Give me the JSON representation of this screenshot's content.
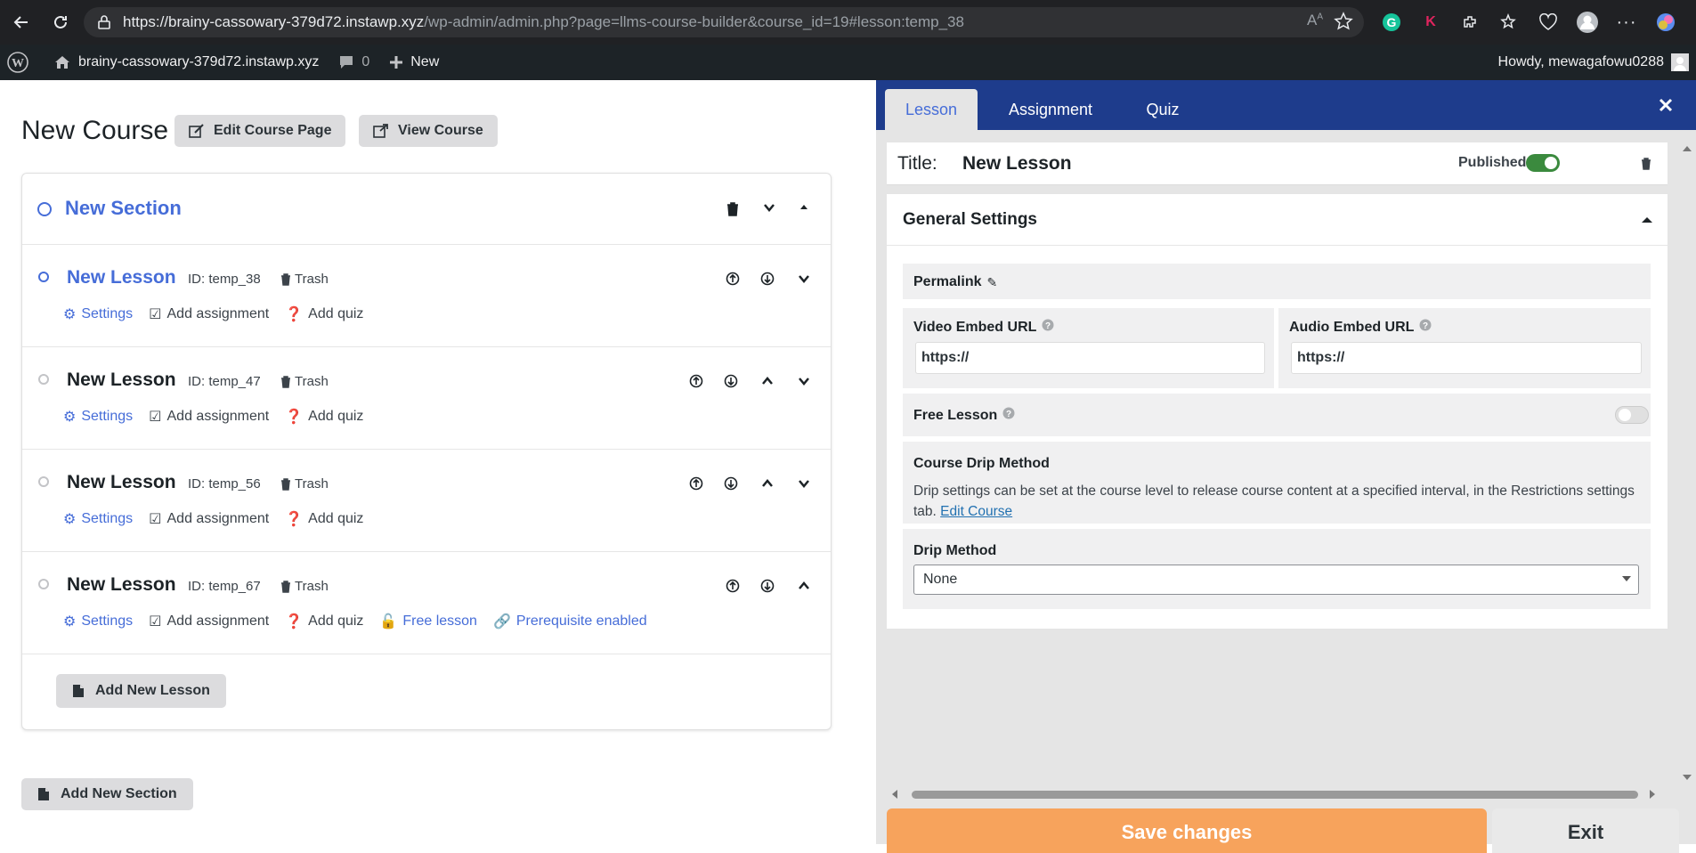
{
  "browser": {
    "url_host": "https://brainy-cassowary-379d72.instawp.xyz",
    "url_path": "/wp-admin/admin.php?page=llms-course-builder&course_id=19#lesson:temp_38"
  },
  "admin_bar": {
    "site_name": "brainy-cassowary-379d72.instawp.xyz",
    "comments_count": "0",
    "new_label": "New",
    "howdy": "Howdy, mewagafowu0288"
  },
  "course": {
    "title": "New Course",
    "edit_page_label": "Edit Course Page",
    "view_course_label": "View Course",
    "add_new_section_label": "Add New Section"
  },
  "section": {
    "title": "New Section",
    "add_new_lesson_label": "Add New Lesson",
    "lessons": [
      {
        "title": "New Lesson",
        "id_label": "ID: temp_38",
        "trash": "Trash",
        "settings": "Settings",
        "add_assignment": "Add assignment",
        "add_quiz": "Add quiz"
      },
      {
        "title": "New Lesson",
        "id_label": "ID: temp_47",
        "trash": "Trash",
        "settings": "Settings",
        "add_assignment": "Add assignment",
        "add_quiz": "Add quiz"
      },
      {
        "title": "New Lesson",
        "id_label": "ID: temp_56",
        "trash": "Trash",
        "settings": "Settings",
        "add_assignment": "Add assignment",
        "add_quiz": "Add quiz"
      },
      {
        "title": "New Lesson",
        "id_label": "ID: temp_67",
        "trash": "Trash",
        "settings": "Settings",
        "add_assignment": "Add assignment",
        "add_quiz": "Add quiz",
        "free_lesson": "Free lesson",
        "prerequisite": "Prerequisite enabled"
      }
    ]
  },
  "panel": {
    "tabs": [
      "Lesson",
      "Assignment",
      "Quiz"
    ],
    "title_label": "Title:",
    "title_value": "New Lesson",
    "published_label": "Published",
    "general_settings": "General Settings",
    "permalink_label": "Permalink",
    "video_label": "Video Embed URL",
    "video_value": "https://",
    "audio_label": "Audio Embed URL",
    "audio_value": "https://",
    "free_lesson_label": "Free Lesson",
    "drip_title": "Course Drip Method",
    "drip_desc": "Drip settings can be set at the course level to release course content at a specified interval, in the Restrictions settings tab.",
    "drip_link": "Edit Course",
    "drip_method_label": "Drip Method",
    "drip_method_value": "None",
    "save_label": "Save changes",
    "exit_label": "Exit"
  },
  "colors": {
    "accent_blue": "#466dd8",
    "panel_header": "#1e3c8c",
    "save_orange": "#f7a35c",
    "toggle_green": "#3b8a3e"
  }
}
